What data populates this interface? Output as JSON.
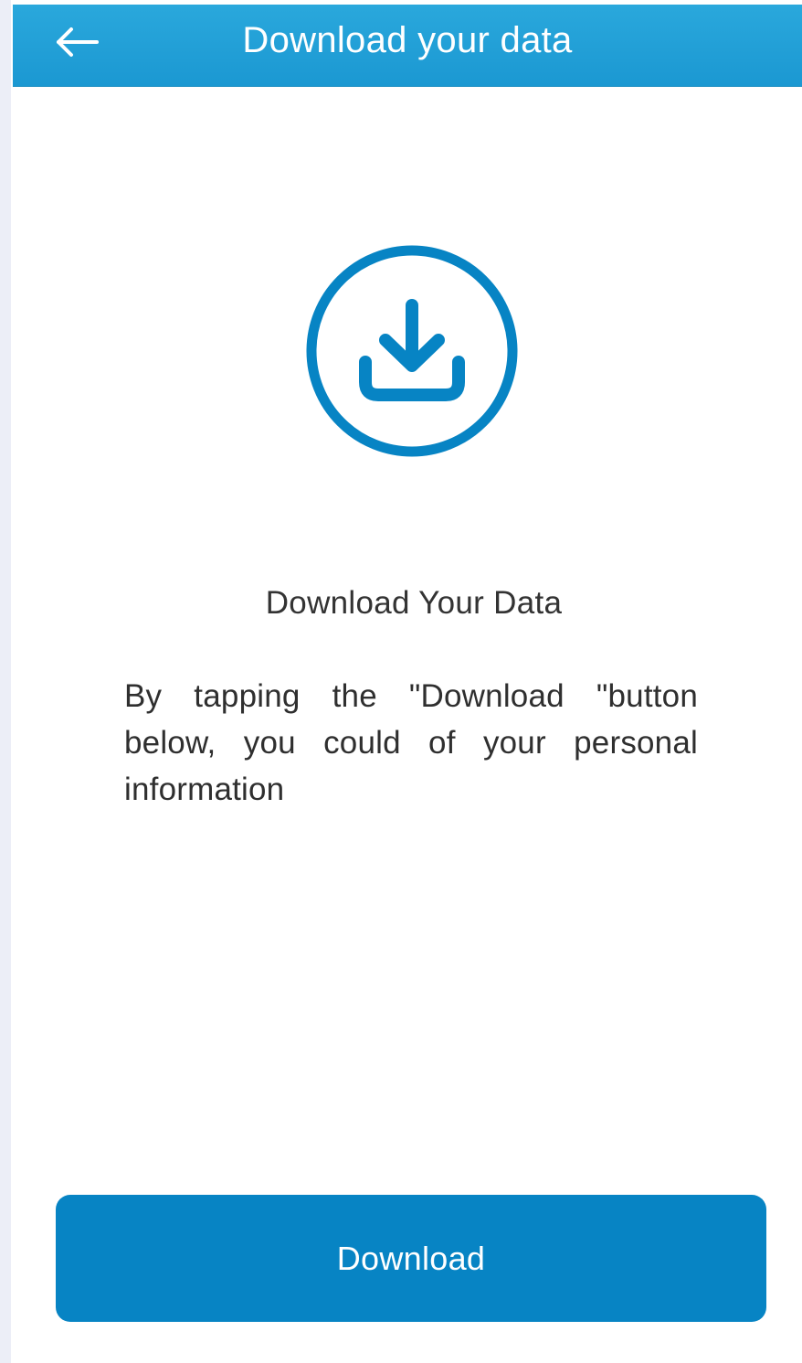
{
  "header": {
    "title": "Download your data",
    "back_icon": "arrow-left-icon"
  },
  "hero": {
    "icon": "download-circle-icon"
  },
  "content": {
    "title": "Download Your Data",
    "description": "By tapping the \"Download \"button below, you could of your personal information"
  },
  "actions": {
    "download_label": "Download"
  },
  "colors": {
    "header_background": "#1d9bd4",
    "accent": "#0784c4",
    "text_primary": "#333333",
    "background": "#ffffff"
  }
}
